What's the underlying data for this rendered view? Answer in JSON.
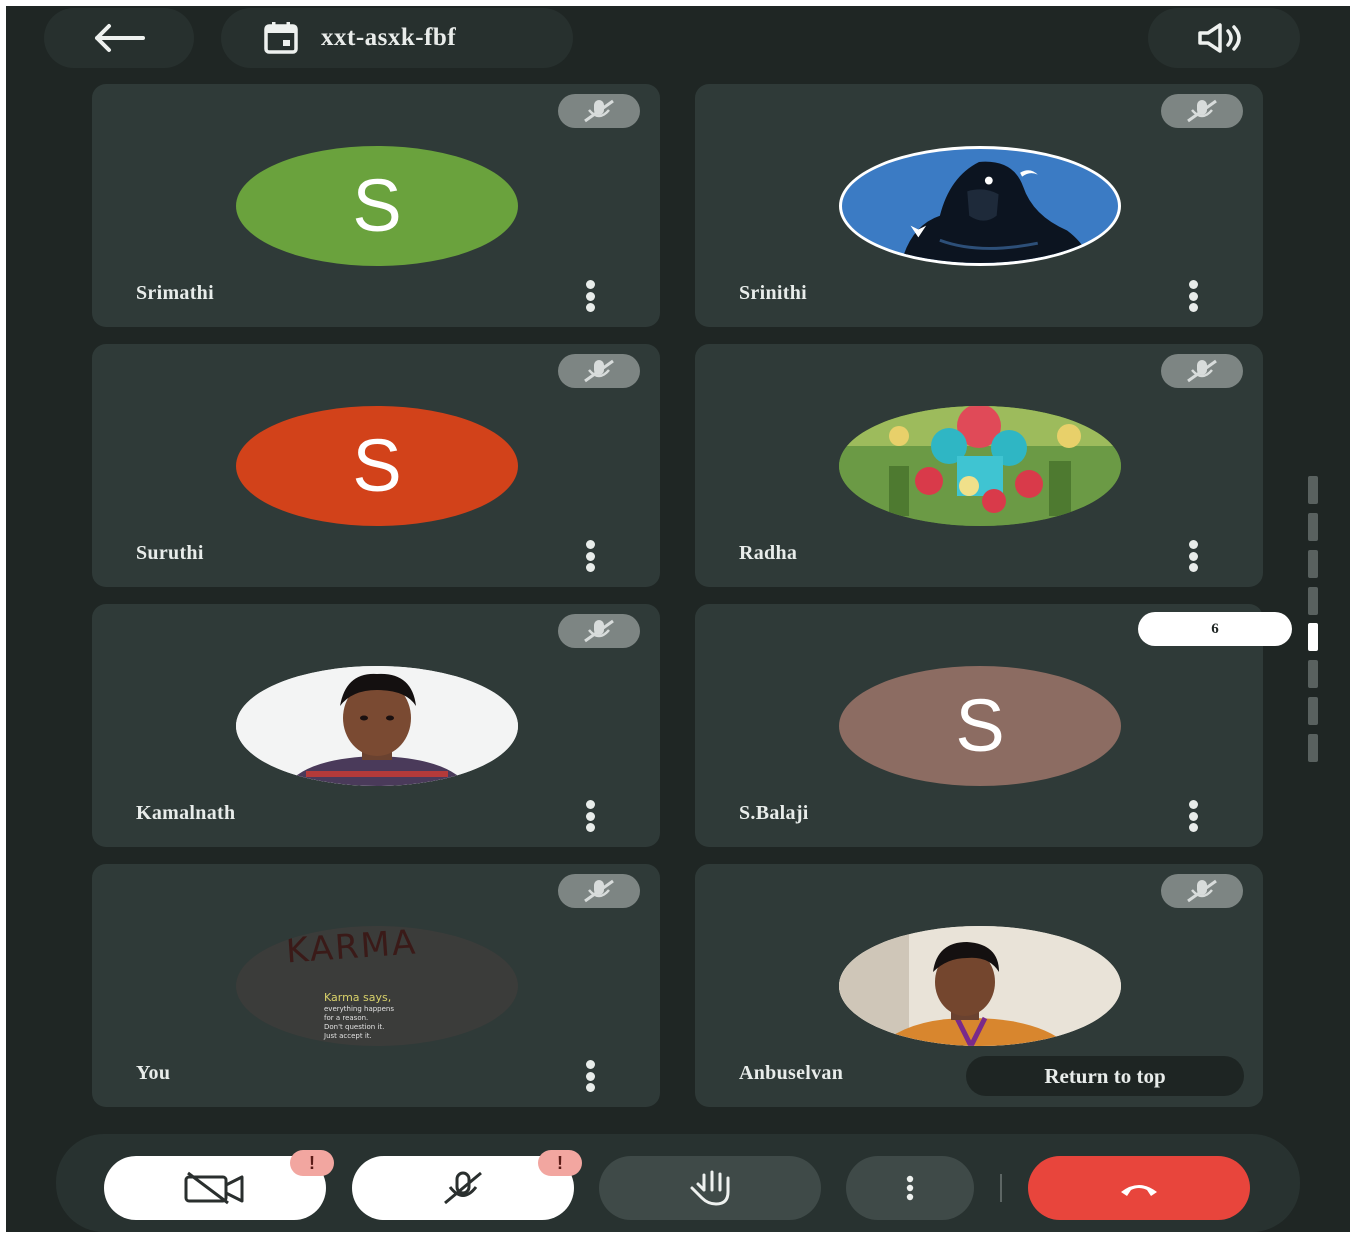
{
  "header": {
    "back_icon": "arrow-left-icon",
    "meeting_code": "xxt-asxk-fbf",
    "calendar_icon": "calendar-icon",
    "speaker_icon": "speaker-icon"
  },
  "participants": [
    {
      "name": "Srimathi",
      "avatar_letter": "S",
      "avatar_color": "#6aa23d"
    },
    {
      "name": "Srinithi",
      "avatar_image": "shiva-illustration"
    },
    {
      "name": "Suruthi",
      "avatar_letter": "S",
      "avatar_color": "#d2421a"
    },
    {
      "name": "Radha",
      "avatar_image": "krishna-picture"
    },
    {
      "name": "Kamalnath",
      "avatar_image": "person-photo"
    },
    {
      "name": "S.Balaji",
      "avatar_letter": "S",
      "avatar_color": "#8c6c62"
    },
    {
      "name": "You",
      "avatar_image": "karma-quote-image"
    },
    {
      "name": "Anbuselvan",
      "avatar_image": "person-photo"
    }
  ],
  "karma_image": {
    "title": "KARMA",
    "quote_heading": "Karma says,",
    "quote_lines": [
      "everything happens",
      "for a reason.",
      "Don't question it.",
      "Just accept it."
    ]
  },
  "scroll": {
    "page_bubble": "6",
    "return_to_top": "Return to top"
  },
  "toolbar": {
    "camera_icon": "camera-off-icon",
    "camera_warning": "!",
    "mic_icon": "mic-off-icon",
    "mic_warning": "!",
    "hand_icon": "raise-hand-icon",
    "more_icon": "more-vertical-icon",
    "end_call_icon": "end-call-icon"
  },
  "colors": {
    "background": "#1f2624",
    "tile": "#2f3a38",
    "end_call": "#e8453c"
  }
}
